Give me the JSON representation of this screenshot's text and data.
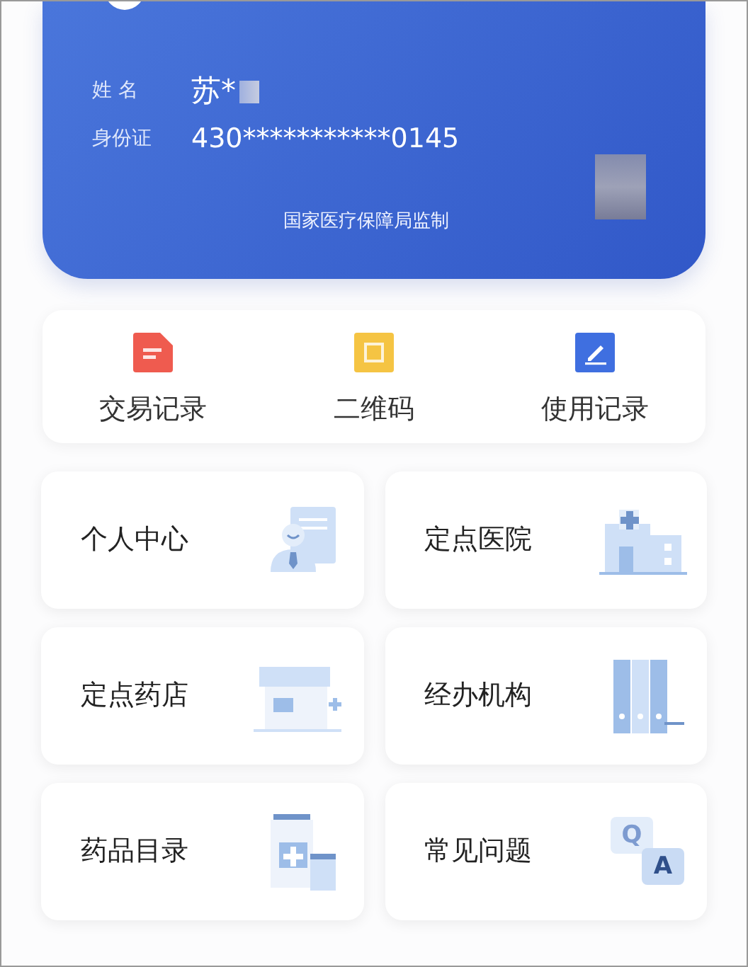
{
  "card": {
    "name_label": "姓 名",
    "name_value": "苏*",
    "id_label": "身份证",
    "id_value": "430***********0145",
    "footer": "国家医疗保障局监制"
  },
  "quick_actions": [
    {
      "label": "交易记录",
      "kind": "document",
      "color": "#ef5b4f"
    },
    {
      "label": "二维码",
      "kind": "qrcode",
      "color": "#f5c443"
    },
    {
      "label": "使用记录",
      "kind": "edit",
      "color": "#3f6fe0"
    }
  ],
  "tiles": [
    {
      "label": "个人中心",
      "kind": "person"
    },
    {
      "label": "定点医院",
      "kind": "hospital"
    },
    {
      "label": "定点药店",
      "kind": "pharmacy"
    },
    {
      "label": "经办机构",
      "kind": "folders"
    },
    {
      "label": "药品目录",
      "kind": "medicine"
    },
    {
      "label": "常见问题",
      "kind": "qa",
      "icon_text": [
        "Q",
        "A"
      ]
    }
  ]
}
